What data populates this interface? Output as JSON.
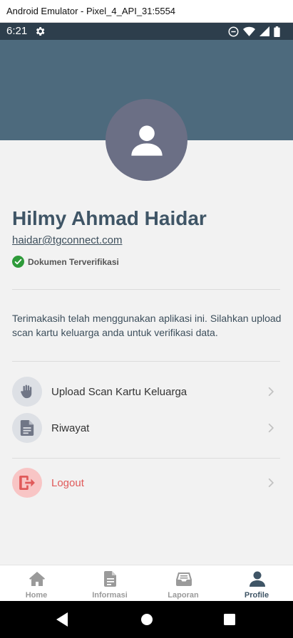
{
  "window": {
    "title": "Android Emulator - Pixel_4_API_31:5554"
  },
  "status_bar": {
    "time": "6:21"
  },
  "profile": {
    "name": "Hilmy Ahmad Haidar",
    "email": "haidar@tgconnect.com",
    "verified_label": "Dokumen Terverifikasi",
    "message": "Terimakasih telah menggunakan aplikasi ini. Silahkan upload scan kartu keluarga anda untuk verifikasi data."
  },
  "menu": {
    "upload": {
      "label": "Upload Scan Kartu Keluarga",
      "icon": "hand-icon"
    },
    "history": {
      "label": "Riwayat",
      "icon": "document-icon"
    },
    "logout": {
      "label": "Logout",
      "icon": "logout-icon"
    }
  },
  "bottom_nav": {
    "home": "Home",
    "info": "Informasi",
    "report": "Laporan",
    "profile": "Profile",
    "active": "Profile"
  },
  "colors": {
    "header": "#4d6a7d",
    "avatar": "#6b6f85",
    "primary_text": "#3f5566",
    "verified": "#2e9b3a",
    "logout": "#e05a5a"
  }
}
